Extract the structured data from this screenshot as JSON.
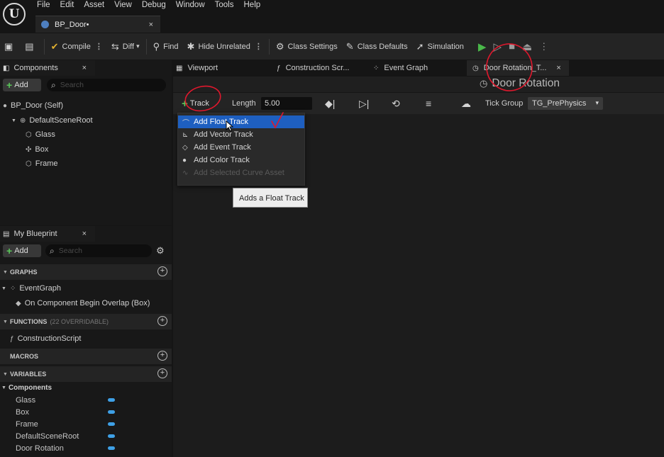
{
  "menu": [
    "File",
    "Edit",
    "Asset",
    "View",
    "Debug",
    "Window",
    "Tools",
    "Help"
  ],
  "document_tab": {
    "label": "BP_Door•",
    "close": "×"
  },
  "toolbar": {
    "compile": "Compile",
    "diff": "Diff",
    "find": "Find",
    "hide_unrelated": "Hide Unrelated",
    "class_settings": "Class Settings",
    "class_defaults": "Class Defaults",
    "simulation": "Simulation"
  },
  "components_panel": {
    "title": "Components",
    "add": "Add",
    "search_placeholder": "Search",
    "items": [
      "BP_Door (Self)",
      "DefaultSceneRoot",
      "Glass",
      "Box",
      "Frame"
    ]
  },
  "my_blueprint": {
    "title": "My Blueprint",
    "add": "Add",
    "search_placeholder": "Search",
    "graphs_label": "GRAPHS",
    "event_graph": "EventGraph",
    "event_node": "On Component Begin Overlap (Box)",
    "functions_label": "FUNCTIONS",
    "functions_sub": "(22 OVERRIDABLE)",
    "construction_script": "ConstructionScript",
    "macros_label": "MACROS",
    "variables_label": "VARIABLES",
    "components_cat": "Components",
    "variables": [
      "Glass",
      "Box",
      "Frame",
      "DefaultSceneRoot",
      "Door Rotation"
    ]
  },
  "editor_tabs": [
    {
      "label": "Viewport"
    },
    {
      "label": "Construction Scr..."
    },
    {
      "label": "Event Graph"
    },
    {
      "label": "Door Rotation_T..."
    }
  ],
  "timeline": {
    "title": "Door Rotation",
    "track_button": "Track",
    "length_label": "Length",
    "length_value": "5.00",
    "tick_group_label": "Tick Group",
    "tick_group_value": "TG_PrePhysics"
  },
  "track_menu": {
    "items": [
      {
        "label": "Add Float Track",
        "icon": "float-track-icon"
      },
      {
        "label": "Add Vector Track",
        "icon": "vector-track-icon"
      },
      {
        "label": "Add Event Track",
        "icon": "event-track-icon"
      },
      {
        "label": "Add Color Track",
        "icon": "color-track-icon"
      },
      {
        "label": "Add Selected Curve Asset",
        "icon": "curve-asset-icon"
      }
    ],
    "tooltip": "Adds a Float Track"
  },
  "colors": {
    "accent_blue": "#1e5fc0",
    "play_green": "#4ab84a",
    "variable_pill": "#3ea0e6",
    "annotation_red": "#e0182d"
  }
}
